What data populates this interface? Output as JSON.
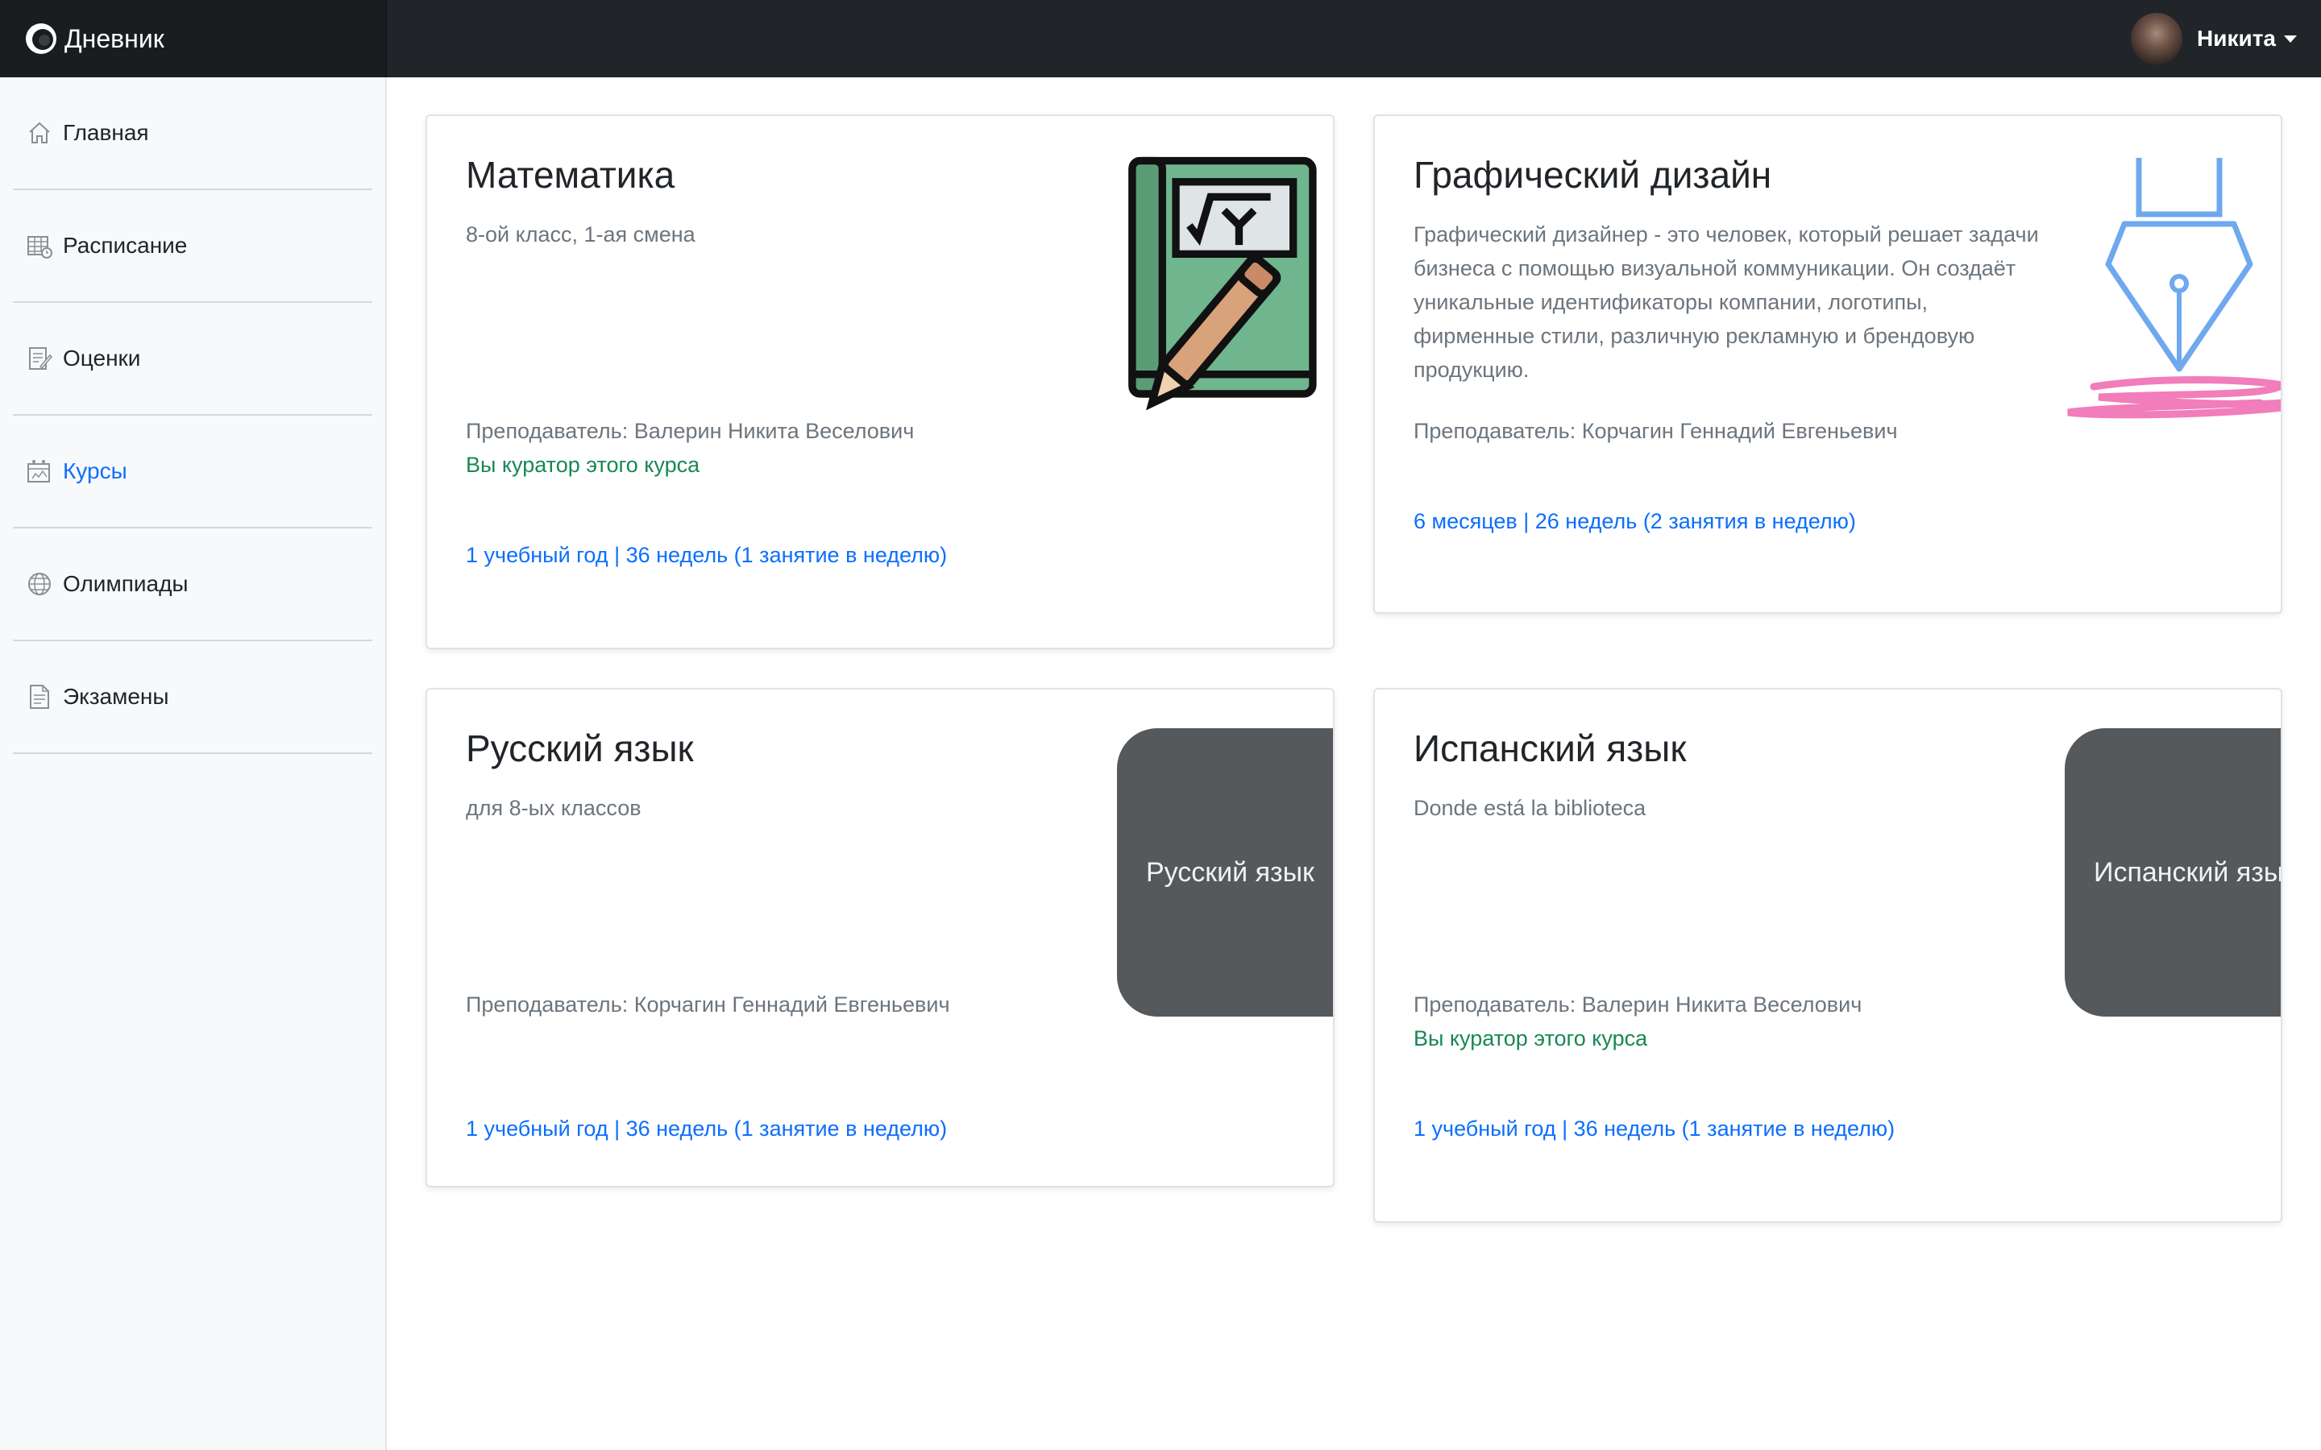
{
  "app": {
    "brand": "Дневник"
  },
  "user": {
    "name": "Никита"
  },
  "sidebar": {
    "items": [
      {
        "label": "Главная",
        "icon": "home-icon"
      },
      {
        "label": "Расписание",
        "icon": "calendar-icon"
      },
      {
        "label": "Оценки",
        "icon": "grades-icon"
      },
      {
        "label": "Курсы",
        "icon": "courses-icon",
        "active": true
      },
      {
        "label": "Олимпиады",
        "icon": "globe-icon"
      },
      {
        "label": "Экзамены",
        "icon": "document-icon"
      }
    ]
  },
  "courses": [
    {
      "title": "Математика",
      "subtitle": "8-ой класс, 1-ая смена",
      "teacher": "Преподаватель: Валерин Никита Веселович",
      "curator": "Вы куратор этого курса",
      "duration": "1 учебный год | 36 недель (1 занятие в неделю)",
      "image": "math-notebook-icon"
    },
    {
      "title": "Графический дизайн",
      "subtitle": "Графический дизайнер - это человек, который решает задачи бизнеса с помощью визуальной коммуникации. Он создаёт уникальные идентификаторы компании, логотипы, фирменные стили, различную рекламную и брендовую продукцию.",
      "teacher": "Преподаватель: Корчагин Геннадий Евгеньевич",
      "duration": "6 месяцев | 26 недель (2 занятия в неделю)",
      "image": "pen-nib-icon"
    },
    {
      "title": "Русский язык",
      "subtitle": "для 8-ых классов",
      "teacher": "Преподаватель: Корчагин Геннадий Евгеньевич",
      "duration": "1 учебный год | 36 недель (1 занятие в неделю)",
      "placeholder": "Русский язык"
    },
    {
      "title": "Испанский язык",
      "subtitle": "Donde está la biblioteca",
      "teacher": "Преподаватель: Валерин Никита Веселович",
      "curator": "Вы куратор этого курса",
      "duration": "1 учебный год | 36 недель (1 занятие в неделю)",
      "placeholder": "Испанский язык"
    }
  ],
  "colors": {
    "link": "#0d6efd",
    "curator": "#198754",
    "topbar": "#212529",
    "placeholder": "#55595c"
  }
}
